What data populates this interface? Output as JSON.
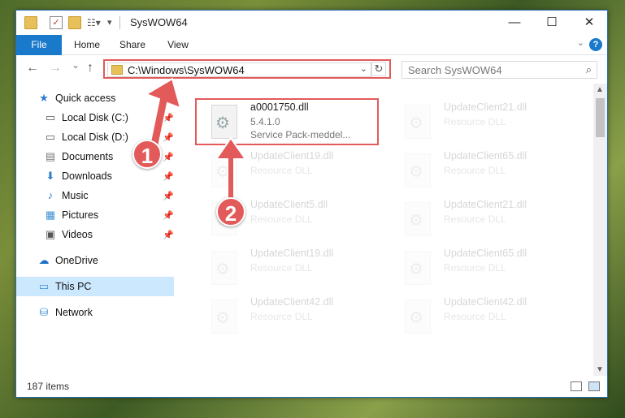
{
  "window": {
    "title": "SysWOW64",
    "controls": {
      "minimize": "—",
      "maximize": "☐",
      "close": "✕"
    }
  },
  "ribbon": {
    "tabs": [
      "File",
      "Home",
      "Share",
      "View"
    ],
    "help": "?"
  },
  "navbar": {
    "back": "←",
    "forward": "→",
    "recent": "⌄",
    "up": "↑",
    "address": "C:\\Windows\\SysWOW64",
    "search_placeholder": "Search SysWOW64"
  },
  "sidebar": {
    "quick_access": "Quick access",
    "items": [
      {
        "label": "Local Disk (C:)",
        "icon": "drive-icon"
      },
      {
        "label": "Local Disk (D:)",
        "icon": "drive-icon"
      },
      {
        "label": "Documents",
        "icon": "documents-icon"
      },
      {
        "label": "Downloads",
        "icon": "downloads-icon"
      },
      {
        "label": "Music",
        "icon": "music-icon"
      },
      {
        "label": "Pictures",
        "icon": "pictures-icon"
      },
      {
        "label": "Videos",
        "icon": "videos-icon"
      }
    ],
    "onedrive": "OneDrive",
    "this_pc": "This PC",
    "network": "Network"
  },
  "files": [
    {
      "name": "a0001750.dll",
      "line1": "5.4.1.0",
      "line2": "Service Pack-meddel...",
      "highlighted": true
    },
    {
      "name": "UpdateClient21.dll",
      "line1": "Resource DLL"
    },
    {
      "name": "UpdateClient19.dll",
      "line1": "Resource DLL"
    },
    {
      "name": "UpdateClient65.dll",
      "line1": "Resource DLL"
    },
    {
      "name": "UpdateClient5.dll",
      "line1": "Resource DLL"
    },
    {
      "name": "UpdateClient21.dll",
      "line1": "Resource DLL"
    },
    {
      "name": "UpdateClient19.dll",
      "line1": "Resource DLL"
    },
    {
      "name": "UpdateClient65.dll",
      "line1": "Resource DLL"
    },
    {
      "name": "UpdateClient42.dll",
      "line1": "Resource DLL"
    },
    {
      "name": "UpdateClient42.dll",
      "line1": "Resource DLL"
    }
  ],
  "status": {
    "items": "187 items"
  },
  "annotations": {
    "step1": "1",
    "step2": "2"
  },
  "colors": {
    "accent": "#1979ca",
    "annotation": "#e25a5a",
    "selection": "#cce8ff"
  }
}
